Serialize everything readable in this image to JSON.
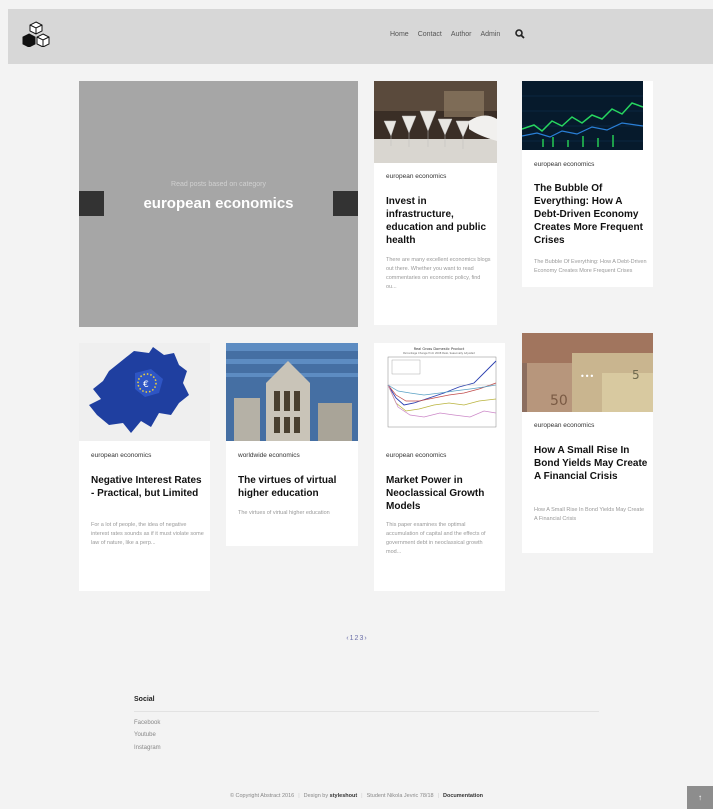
{
  "nav": {
    "items": [
      "Home",
      "Contact",
      "Author",
      "Admin"
    ]
  },
  "featured": {
    "subtitle": "Read posts based on category",
    "category": "european economics"
  },
  "posts": [
    {
      "category": "european economics",
      "title": "Invest in infrastructure, education and public health",
      "excerpt": "There are many excellent economics blogs out there. Whether you want to read commentaries on economic policy, find ou..."
    },
    {
      "category": "european economics",
      "title": "The Bubble Of Everything: How A Debt-Driven Economy Creates More Frequent Crises",
      "excerpt": "The Bubble Of Everything: How A Debt-Driven Economy Creates More Frequent Crises"
    },
    {
      "category": "european economics",
      "title": "Negative Interest Rates - Practical, but Limited",
      "excerpt": "For a lot of people, the idea of negative interest rates sounds as if it must violate some law of nature, like a perp..."
    },
    {
      "category": "worldwide economics",
      "title": "The virtues of virtual higher education",
      "excerpt": "The virtues of virtual higher education"
    },
    {
      "category": "european economics",
      "title": "Market Power in Neoclassical Growth Models",
      "excerpt": "This paper examines the optimal accumulation of capital and the effects of government debt in neoclassical growth mod..."
    },
    {
      "category": "european economics",
      "title": "How A Small Rise In Bond Yields May Create A Financial Crisis",
      "excerpt": "How A Small Rise In Bond Yields May Create A Financial Crisis"
    }
  ],
  "pagination": {
    "prev": "‹",
    "pages": [
      "1",
      "2",
      "3"
    ],
    "next": "›"
  },
  "footer": {
    "social_heading": "Social",
    "links": [
      "Facebook",
      "Youtube",
      "Instagram"
    ],
    "copyright": "© Copyright Abstract 2016",
    "design_by": "Design by",
    "designer": "styleshout",
    "student": "Student Nikola Jevric 78/18",
    "documentation": "Documentation",
    "to_top": "↑"
  },
  "chart_thumb_title": "Real Gross Domestic Product",
  "chart_thumb_subtitle": "Percentage Change from 2008 Peak, Seasonally Adjusted",
  "colors": {
    "header_bg": "#d7d7d7",
    "page_bg": "#f3f3f3",
    "featured_bg": "#a6a6a6",
    "accent": "#6b6fa8"
  }
}
